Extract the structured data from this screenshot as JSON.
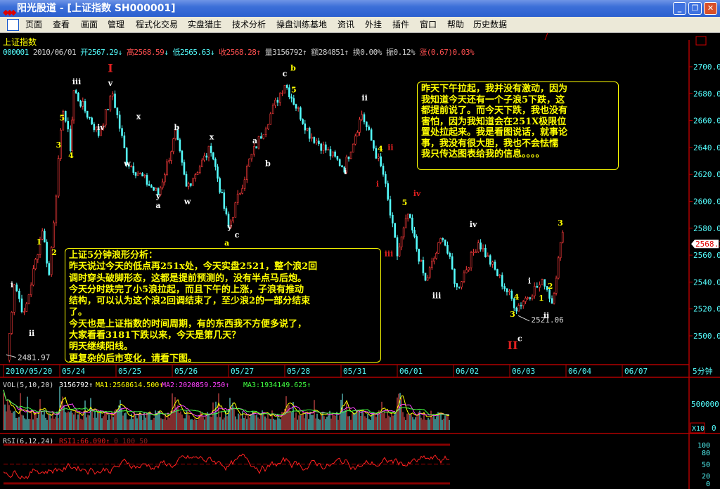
{
  "window": {
    "title": "阳光股道 - [上证指数 SH000001]",
    "min": "_",
    "restore": "❐",
    "close": "✕"
  },
  "menu": [
    "页面",
    "查看",
    "画面",
    "管理",
    "程式化交易",
    "实盘猎庄",
    "技术分析",
    "操盘训练基地",
    "资讯",
    "外挂",
    "插件",
    "窗口",
    "帮助",
    "历史数据"
  ],
  "stock": {
    "name": "上证指数",
    "code": "000001",
    "date": "2010/06/01",
    "open": "开2567.29",
    "high": "高2568.59",
    "low": "低2565.63",
    "close": "收2568.28",
    "vol": "量3156792",
    "amount": "额284851",
    "turnover": "换0.00%",
    "amplitude": "振0.12%",
    "change": "涨(0.67)0.03%"
  },
  "notes": {
    "right": [
      "昨天下午拉起，我并没有激动，因为",
      "我知道今天还有一个子浪5下跌，这",
      "都提前说了。而今天下跌，我也没有",
      "害怕，因为我知道会在251X极限位",
      "置处拉起来。我是看图说话，就事论",
      "事，我没有很大胆，我也不会怯懦",
      "我只传达图表给我的信息。。。。"
    ],
    "left": [
      "上证5分钟浪形分析：",
      "昨天说过今天的低点再251x处，今天实盘2521，整个浪2回",
      "调时穿头破脚形态，这都是提前预测的，没有半点马后炮。",
      "今天分时跌完了小5浪拉起，而且下午的上涨，子浪有推动",
      "结构，可以认为这个浪2回调结束了，至少浪2的一部分结束",
      "了。",
      "今天也是上证指数的时间周期，有的东西我不方便多说了，",
      "大家看看3181下跌以来，今天是第几天？",
      "明天继续阳线。",
      "更复杂的后市变化，请看下图。"
    ]
  },
  "colors": {
    "up": "#ff3c3c",
    "down": "#54fcfc",
    "axis": "#c00000",
    "text": "#54fcfc",
    "note": "#ffff00"
  },
  "chart_data": [
    {
      "type": "candlestick",
      "title": "上证指数 5分钟",
      "ylim": [
        2480,
        2712
      ],
      "yticks": [
        "2700.0",
        "2680.0",
        "2660.0",
        "2640.0",
        "2620.0",
        "2600.0",
        "2580.0",
        "2560.0",
        "2540.0",
        "2520.0",
        "2500.0"
      ],
      "last_price": "2568.3",
      "xticks": [
        "2010/05/20",
        "05/24",
        "05/25",
        "05/26",
        "05/27",
        "05/28",
        "05/31",
        "06/01",
        "06/02",
        "06/03",
        "06/04",
        "06/07"
      ],
      "period": "5分钟",
      "path": [
        [
          0.06,
          2482
        ],
        [
          0.19,
          2540
        ],
        [
          0.37,
          2515
        ],
        [
          0.69,
          2580
        ],
        [
          0.81,
          2545
        ],
        [
          1.06,
          2670
        ],
        [
          1.19,
          2640
        ],
        [
          1.25,
          2682
        ],
        [
          1.69,
          2650
        ],
        [
          1.94,
          2680
        ],
        [
          2.19,
          2630
        ],
        [
          2.75,
          2605
        ],
        [
          3.06,
          2650
        ],
        [
          3.25,
          2610
        ],
        [
          3.69,
          2640
        ],
        [
          4.0,
          2580
        ],
        [
          4.37,
          2630
        ],
        [
          5.0,
          2688
        ],
        [
          5.44,
          2650
        ],
        [
          6.06,
          2625
        ],
        [
          6.37,
          2665
        ],
        [
          6.75,
          2620
        ],
        [
          7.0,
          2560
        ],
        [
          7.19,
          2590
        ],
        [
          7.5,
          2540
        ],
        [
          7.81,
          2575
        ],
        [
          8.06,
          2535
        ],
        [
          8.44,
          2570
        ],
        [
          9.12,
          2521
        ],
        [
          9.44,
          2535
        ],
        [
          9.62,
          2540
        ],
        [
          9.75,
          2525
        ],
        [
          9.94,
          2577
        ]
      ],
      "wave_labels": [
        {
          "t": "I",
          "x": 1.9,
          "p": 2696,
          "c": "#e02020",
          "big": true
        },
        {
          "t": "II",
          "x": 9.05,
          "p": 2490,
          "c": "#e02020",
          "big": true
        },
        {
          "t": "iii",
          "x": 1.3,
          "p": 2687,
          "c": "#fff"
        },
        {
          "t": "iv",
          "x": 1.73,
          "p": 2653,
          "c": "#fff"
        },
        {
          "t": "v",
          "x": 1.9,
          "p": 2686,
          "c": "#fff"
        },
        {
          "t": "i",
          "x": 0.15,
          "p": 2536,
          "c": "#fff"
        },
        {
          "t": "ii",
          "x": 0.5,
          "p": 2500,
          "c": "#fff"
        },
        {
          "t": "x",
          "x": 2.4,
          "p": 2661,
          "c": "#fff"
        },
        {
          "t": "w",
          "x": 2.2,
          "p": 2626,
          "c": "#fff"
        },
        {
          "t": "y",
          "x": 2.75,
          "p": 2602,
          "c": "#fff"
        },
        {
          "t": "a",
          "x": 2.75,
          "p": 2595,
          "c": "#fff"
        },
        {
          "t": "b",
          "x": 3.08,
          "p": 2653,
          "c": "#fff"
        },
        {
          "t": "w",
          "x": 3.27,
          "p": 2598,
          "c": "#fff"
        },
        {
          "t": "x",
          "x": 3.7,
          "p": 2646,
          "c": "#fff"
        },
        {
          "t": "y",
          "x": 4.02,
          "p": 2579,
          "c": "#fff"
        },
        {
          "t": "c",
          "x": 4.15,
          "p": 2573,
          "c": "#fff"
        },
        {
          "t": "a",
          "x": 3.97,
          "p": 2567,
          "c": "#ff0"
        },
        {
          "t": "a",
          "x": 4.47,
          "p": 2643,
          "c": "#fff"
        },
        {
          "t": "b",
          "x": 4.7,
          "p": 2626,
          "c": "#fff"
        },
        {
          "t": "c",
          "x": 5.0,
          "p": 2693,
          "c": "#fff"
        },
        {
          "t": "b",
          "x": 5.15,
          "p": 2697,
          "c": "#ff0"
        },
        {
          "t": "ii",
          "x": 6.42,
          "p": 2675,
          "c": "#fff"
        },
        {
          "t": "i",
          "x": 6.08,
          "p": 2620,
          "c": "#fff"
        },
        {
          "t": "ii",
          "x": 6.88,
          "p": 2638,
          "c": "#e02020"
        },
        {
          "t": "i",
          "x": 6.65,
          "p": 2611,
          "c": "#e02020"
        },
        {
          "t": "iv",
          "x": 7.35,
          "p": 2604,
          "c": "#e02020"
        },
        {
          "t": "iii",
          "x": 6.85,
          "p": 2559,
          "c": "#e02020"
        },
        {
          "t": "iii",
          "x": 7.7,
          "p": 2528,
          "c": "#fff"
        },
        {
          "t": "iv",
          "x": 8.35,
          "p": 2581,
          "c": "#fff"
        },
        {
          "t": "i",
          "x": 9.35,
          "p": 2539,
          "c": "#fff"
        },
        {
          "t": "ii",
          "x": 9.65,
          "p": 2513,
          "c": "#fff"
        },
        {
          "t": "c",
          "x": 9.18,
          "p": 2496,
          "c": "#fff"
        },
        {
          "t": "5",
          "x": 1.04,
          "p": 2660,
          "c": "#ff0"
        },
        {
          "t": "3",
          "x": 0.98,
          "p": 2640,
          "c": "#ff0"
        },
        {
          "t": "4",
          "x": 1.2,
          "p": 2632,
          "c": "#ff0"
        },
        {
          "t": "1",
          "x": 0.63,
          "p": 2568,
          "c": "#ff0"
        },
        {
          "t": "2",
          "x": 0.9,
          "p": 2560,
          "c": "#ff0"
        },
        {
          "t": "3",
          "x": 9.9,
          "p": 2582,
          "c": "#ff0"
        },
        {
          "t": "2",
          "x": 9.72,
          "p": 2535,
          "c": "#ff0"
        },
        {
          "t": "1",
          "x": 9.56,
          "p": 2526,
          "c": "#ff0"
        },
        {
          "t": "5",
          "x": 7.13,
          "p": 2597,
          "c": "#ff0"
        },
        {
          "t": "4",
          "x": 6.7,
          "p": 2637,
          "c": "#ff0"
        },
        {
          "t": "5",
          "x": 5.16,
          "p": 2681,
          "c": "#ff0"
        },
        {
          "t": "3",
          "x": 9.05,
          "p": 2514,
          "c": "#ff0"
        },
        {
          "t": "4",
          "x": 9.12,
          "p": 2527,
          "c": "#ff0"
        }
      ],
      "price_labels": [
        {
          "t": "2521.06",
          "x": 9.38,
          "p": 2510
        },
        {
          "t": "2481.97",
          "x": 0.25,
          "p": 2482
        }
      ]
    },
    {
      "type": "bar",
      "title": "VOL(5,10,20)",
      "value": "3156792",
      "ma": [
        {
          "name": "MA1:2568614.500",
          "color": "#ffff00"
        },
        {
          "name": "MA2:2020859.250",
          "color": "#ff40ff"
        },
        {
          "name": "MA3:1934149.625",
          "color": "#40ff40"
        }
      ],
      "yticks": [
        "500000",
        "0"
      ],
      "scale": "X10"
    },
    {
      "type": "line",
      "title": "RSI(6,12,24)",
      "value": "RSI1:66.090",
      "extra": "0 100 50",
      "yticks": [
        "100",
        "80",
        "50",
        "20",
        "0"
      ],
      "ylim": [
        0,
        100
      ]
    }
  ]
}
